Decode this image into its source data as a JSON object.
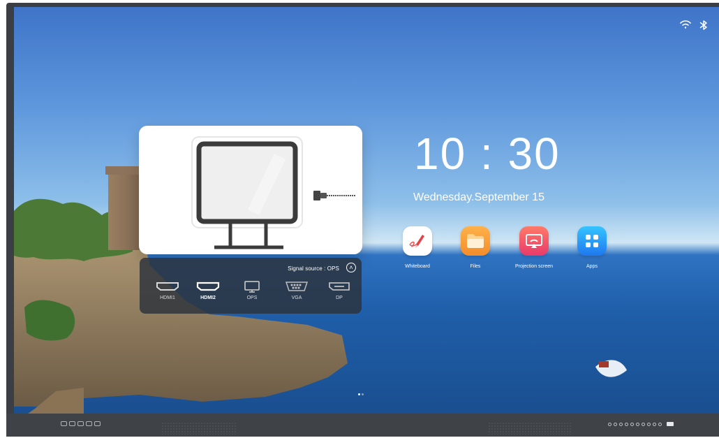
{
  "status": {
    "wifi_icon": "wifi-icon",
    "bluetooth_icon": "bluetooth-icon"
  },
  "clock": {
    "time": "10 : 30",
    "date": "Wednesday.September 15"
  },
  "signal_panel": {
    "source_label": "Signal source : OPS",
    "inputs": [
      "HDMI1",
      "HDMI2",
      "OPS",
      "VGA",
      "DP"
    ],
    "selected": "HDMI2"
  },
  "apps": [
    {
      "label": "Whiteboard",
      "icon": "pen-icon",
      "color": "#ffffff"
    },
    {
      "label": "Files",
      "icon": "folder-icon",
      "color": "#f59d36"
    },
    {
      "label": "Projection screen",
      "icon": "screen-cast-icon",
      "color": "#ec4f69"
    },
    {
      "label": "Apps",
      "icon": "grid-icon",
      "color": "#2f8af4"
    }
  ],
  "page_indicator": {
    "current": 1,
    "total": 2
  },
  "colors": {
    "panel": "#2c323a",
    "screen_frame": "#3b3f44"
  }
}
